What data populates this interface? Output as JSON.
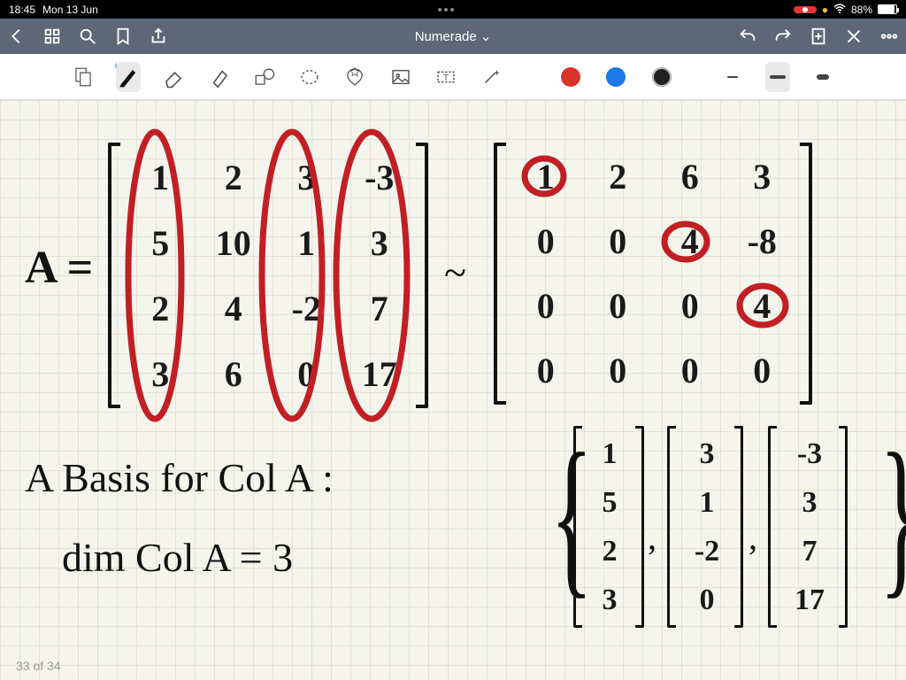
{
  "statusbar": {
    "time": "18:45",
    "date": "Mon 13 Jun",
    "wifi_icon": "wifi",
    "battery_pct": "88%",
    "battery_fill_pct": 88,
    "recording": true
  },
  "navbar": {
    "title": "Numerade",
    "dropdown_glyph": "⌄",
    "icons_left": [
      "back",
      "grid-view",
      "search",
      "bookmark",
      "share"
    ],
    "icons_right": [
      "undo",
      "redo",
      "new-page",
      "close",
      "more"
    ]
  },
  "toolbar": {
    "tools": [
      "page-template",
      "pen",
      "eraser",
      "highlighter",
      "shapes",
      "lasso",
      "favorites",
      "image",
      "text-box",
      "magic-wand"
    ],
    "selected_tool": "pen",
    "bluetooth_indicator": true,
    "colors": {
      "red": "#d9342b",
      "blue": "#1c78e6",
      "dark": "#222222"
    },
    "selected_color": "dark",
    "stroke_widths": [
      "thin",
      "medium",
      "thick"
    ],
    "selected_stroke": "medium"
  },
  "page_indicator": "33 of 34",
  "notes": {
    "lhs_label": "A =",
    "tilde": "~",
    "matrix_A": [
      [
        "1",
        "2",
        "3",
        "-3"
      ],
      [
        "5",
        "10",
        "1",
        "3"
      ],
      [
        "2",
        "4",
        "-2",
        "7"
      ],
      [
        "3",
        "6",
        "0",
        "17"
      ]
    ],
    "matrix_R": [
      [
        "1",
        "2",
        "6",
        "3"
      ],
      [
        "0",
        "0",
        "4",
        "-8"
      ],
      [
        "0",
        "0",
        "0",
        "4"
      ],
      [
        "0",
        "0",
        "0",
        "0"
      ]
    ],
    "A_circled_columns": [
      0,
      2,
      3
    ],
    "R_circled_cells": [
      [
        0,
        0
      ],
      [
        1,
        2
      ],
      [
        2,
        3
      ]
    ],
    "basis_text": "A Basis for Col A :",
    "dim_text": "dim Col A = 3",
    "basis_vectors": [
      [
        "1",
        "5",
        "2",
        "3"
      ],
      [
        "3",
        "1",
        "-2",
        "0"
      ],
      [
        "-3",
        "3",
        "7",
        "17"
      ]
    ]
  }
}
